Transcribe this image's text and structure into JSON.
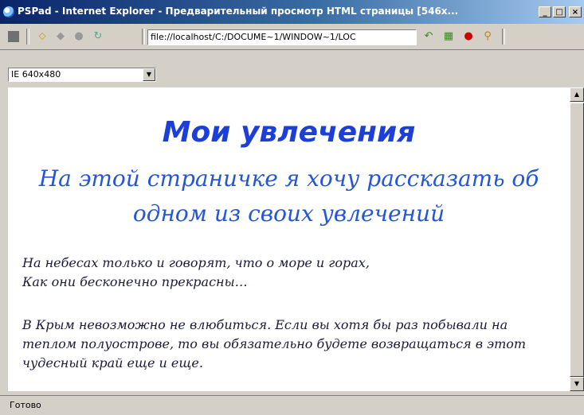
{
  "window": {
    "title": "PSPad - Internet Explorer - Предварительный просмотр HTML страницы  [546x...",
    "buttons": {
      "minimize": "_",
      "maximize": "□",
      "close": "×"
    }
  },
  "toolbar": {
    "address": "file://localhost/C:/DOCUME~1/WINDOW~1/LOC",
    "icons": [
      "stop-square-icon",
      "back-icon",
      "forward-icon",
      "stop-icon",
      "refresh-icon",
      "go-icon",
      "grid-icon",
      "error-icon",
      "search-icon"
    ]
  },
  "viewport_select": {
    "value": "IE 640x480",
    "arrow": "▼"
  },
  "page": {
    "heading": "Мои увлечения",
    "subheading": "На этой страничке я хочу рассказать об одном из своих увлечений",
    "paragraph1_line1": "На небесах только и говорят, что о море и горах,",
    "paragraph1_line2": "Как они бесконечно прекрасны…",
    "paragraph2": "В Крым невозможно не влюбиться. Если вы хотя бы раз побывали на теплом полуострове, то вы обязательно будете возвращаться в этот чудесный край еще и еще."
  },
  "scrollbar": {
    "up": "▲",
    "down": "▼"
  },
  "status": {
    "text": "Готово"
  },
  "colors": {
    "heading": "#1c3fd8",
    "subheading": "#2456d6",
    "titlebar": "#0a246a"
  }
}
